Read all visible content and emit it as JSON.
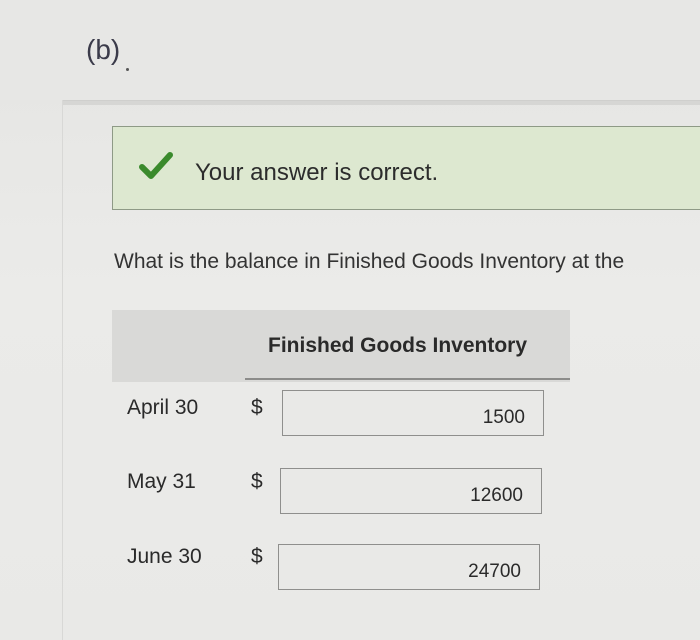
{
  "part": {
    "label": "(b)"
  },
  "feedback": {
    "message": "Your answer is correct.",
    "status_color": "#dde8d0"
  },
  "question": {
    "text": "What is the balance in Finished Goods Inventory at the"
  },
  "table": {
    "title": "Finished Goods Inventory",
    "rows": [
      {
        "label": "April 30",
        "currency": "$",
        "value": "1500"
      },
      {
        "label": "May 31",
        "currency": "$",
        "value": "12600"
      },
      {
        "label": "June 30",
        "currency": "$",
        "value": "24700"
      }
    ]
  }
}
